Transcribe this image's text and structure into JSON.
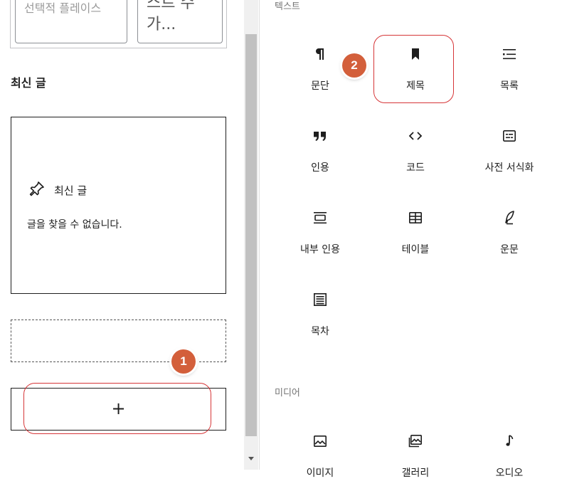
{
  "left": {
    "top_input_1": "선택적 플레이스",
    "top_input_2_line1": "스트 수",
    "top_input_2_line2": "가...",
    "section_title": "최신 글",
    "latest_posts_block": {
      "title": "최신 글",
      "empty_message": "글을 찾을 수 없습니다."
    },
    "add_block_symbol": "+",
    "annotation_1": "1"
  },
  "right": {
    "annotation_2": "2",
    "categories": [
      {
        "label": "텍스트",
        "items": [
          {
            "label": "문단",
            "icon": "paragraph-icon"
          },
          {
            "label": "제목",
            "icon": "bookmark-icon"
          },
          {
            "label": "목록",
            "icon": "list-icon"
          },
          {
            "label": "인용",
            "icon": "quote-icon"
          },
          {
            "label": "코드",
            "icon": "code-icon"
          },
          {
            "label": "사전 서식화",
            "icon": "preformatted-icon"
          },
          {
            "label": "내부 인용",
            "icon": "pullquote-icon"
          },
          {
            "label": "테이블",
            "icon": "table-icon"
          },
          {
            "label": "운문",
            "icon": "verse-icon"
          },
          {
            "label": "목차",
            "icon": "table-of-contents-icon"
          }
        ]
      },
      {
        "label": "미디어",
        "items": [
          {
            "label": "이미지",
            "icon": "image-icon"
          },
          {
            "label": "갤러리",
            "icon": "gallery-icon"
          },
          {
            "label": "오디오",
            "icon": "audio-icon"
          }
        ]
      }
    ]
  },
  "colors": {
    "annotation_badge": "#d35f3b",
    "highlight_ring": "#d63638",
    "text": "#1e1e1e",
    "category_text": "#757575"
  }
}
